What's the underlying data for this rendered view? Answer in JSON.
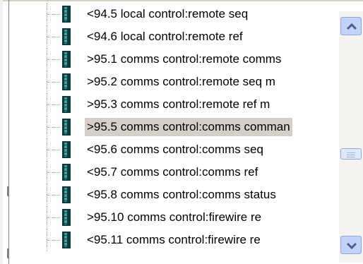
{
  "tree": {
    "items": [
      {
        "label": "<94.5 local control:remote seq",
        "selected": false
      },
      {
        "label": "<94.6 local control:remote ref",
        "selected": false
      },
      {
        "label": ">95.1 comms control:remote comms",
        "selected": false
      },
      {
        "label": ">95.2 comms control:remote seq m",
        "selected": false
      },
      {
        "label": ">95.3 comms control:remote ref m",
        "selected": false
      },
      {
        "label": ">95.5 comms control:comms comman",
        "selected": true
      },
      {
        "label": "<95.6 comms control:comms seq",
        "selected": false
      },
      {
        "label": "<95.7 comms control:comms ref",
        "selected": false
      },
      {
        "label": "<95.8 comms control:comms status",
        "selected": false
      },
      {
        "label": ">95.10 comms control:firewire re",
        "selected": false
      },
      {
        "label": "<95.11 comms control:firewire re",
        "selected": false
      }
    ],
    "item_icon": "parameter-block-icon"
  },
  "scrollbar": {
    "up_icon": "chevron-up-icon",
    "down_icon": "chevron-down-icon",
    "thumb_position": 0.6
  },
  "colors": {
    "selection_bg": "#d4d0c8",
    "icon_dark": "#0a3a3a",
    "icon_light": "#3aa0a0",
    "scroll_button": "#c1d3fb"
  }
}
